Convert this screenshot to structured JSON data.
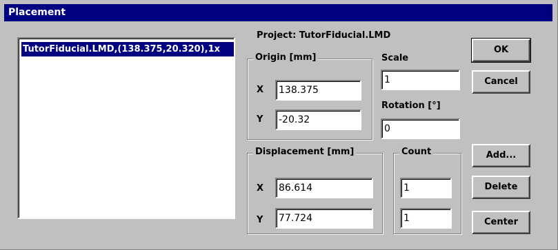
{
  "window": {
    "title": "Placement"
  },
  "list": {
    "items": [
      "TutorFiducial.LMD,(138.375,20.320),1x"
    ]
  },
  "project_label": "Project: TutorFiducial.LMD",
  "origin": {
    "title": "Origin [mm]",
    "x_label": "X",
    "y_label": "Y",
    "x_value": "138.375",
    "y_value": "-20.32"
  },
  "scale": {
    "label": "Scale",
    "value": "1"
  },
  "rotation": {
    "label": "Rotation [°]",
    "value": "0"
  },
  "displacement": {
    "title": "Displacement [mm]",
    "x_label": "X",
    "y_label": "Y",
    "x_value": "86.614",
    "y_value": "77.724"
  },
  "count": {
    "title": "Count",
    "x_value": "1",
    "y_value": "1"
  },
  "buttons": {
    "ok": "OK",
    "cancel": "Cancel",
    "add": "Add...",
    "delete": "Delete",
    "center": "Center"
  }
}
